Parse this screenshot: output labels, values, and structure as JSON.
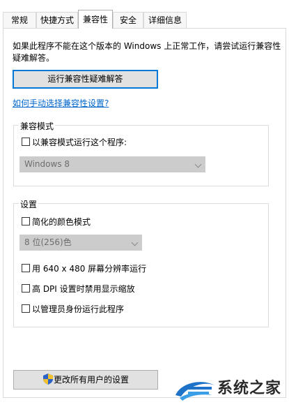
{
  "tabs": [
    {
      "label": "常规",
      "active": false
    },
    {
      "label": "快捷方式",
      "active": false
    },
    {
      "label": "兼容性",
      "active": true
    },
    {
      "label": "安全",
      "active": false
    },
    {
      "label": "详细信息",
      "active": false
    }
  ],
  "description": "如果此程序不能在这个版本的 Windows 上正常工作，请尝试运行兼容性疑难解答。",
  "troubleshooter_button": "运行兼容性疑难解答",
  "manual_link": "如何手动选择兼容性设置?",
  "compat_mode": {
    "legend": "兼容模式",
    "checkbox_label": "以兼容模式运行这个程序:",
    "checked": false,
    "os_value": "Windows 8"
  },
  "settings": {
    "legend": "设置",
    "reduced_color_label": "简化的颜色模式",
    "color_value": "8 位(256)色",
    "res640_label": "用 640 x 480 屏幕分辨率运行",
    "dpi_label": "高 DPI 设置时禁用显示缩放",
    "admin_label": "以管理员身份运行此程序"
  },
  "all_users_button": "更改所有用户的设置",
  "watermark_text": "系统之家",
  "colors": {
    "accent": "#0078d7",
    "link": "#0066cc",
    "disabled_bg": "#cccccc"
  }
}
